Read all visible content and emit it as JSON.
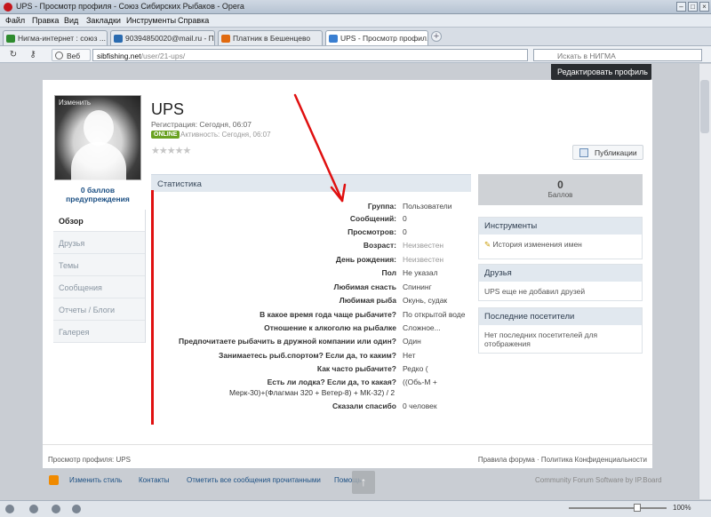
{
  "window": {
    "title": "UPS - Просмотр профиля - Союз Сибирских Рыбаков - Opera"
  },
  "menu": [
    "Файл",
    "Правка",
    "Вид",
    "Закладки",
    "Инструменты",
    "Справка"
  ],
  "tabs": [
    {
      "label": "Нигма-интернет : союз ...",
      "color": "#2e8b2e"
    },
    {
      "label": "90394850020@mail.ru - П...",
      "color": "#2a6bb0"
    },
    {
      "label": "Платник в Бешенцево",
      "color": "#e06a10"
    },
    {
      "label": "UPS - Просмотр профил...",
      "color": "#3a7fd1"
    }
  ],
  "address": {
    "web_label": "Веб",
    "host": "sibfishing.net",
    "path": "/user/21-ups/",
    "search_placeholder": "Искать в НИГМА"
  },
  "page": {
    "edit_profile": "Редактировать профиль",
    "avatar_change": "Изменить",
    "points_link": "0 баллов предупреждения",
    "nav": [
      "Обзор",
      "Друзья",
      "Темы",
      "Сообщения",
      "Отчеты / Блоги",
      "Галерея"
    ],
    "username": "UPS",
    "registration": "Регистрация: Сегодня, 06:07",
    "online_badge": "ONLINE",
    "activity": "Активность: Сегодня, 06:07",
    "stars": "★★★★★",
    "publications_button": "Публикации",
    "stats_header": "Статистика",
    "stats": [
      {
        "label": "Группа:",
        "value": "Пользователи",
        "gray": false
      },
      {
        "label": "Сообщений:",
        "value": "0",
        "gray": false
      },
      {
        "label": "Просмотров:",
        "value": "0",
        "gray": false
      },
      {
        "label": "Возраст:",
        "value": "Неизвестен",
        "gray": true
      },
      {
        "label": "День рождения:",
        "value": "Неизвестен",
        "gray": true
      },
      {
        "label": "Пол",
        "value": "Не указал",
        "gray": false
      },
      {
        "label": "Любимая снасть",
        "value": "Спининг",
        "gray": false
      },
      {
        "label": "Любимая рыба",
        "value": "Окунь, судак",
        "gray": false
      },
      {
        "label": "В какое время года чаще рыбачите?",
        "value": "По открытой воде",
        "gray": false
      },
      {
        "label": "Отношение к алкоголю на рыбалке",
        "value": "Сложное...",
        "gray": false
      },
      {
        "label": "Предпочитаете рыбачить в дружной компании или один?",
        "value": "Один",
        "gray": false
      },
      {
        "label": "Занимаетесь рыб.спортом? Если да, то каким?",
        "value": "Нет",
        "gray": false
      },
      {
        "label": "Как часто рыбачите?",
        "value": "Редко (",
        "gray": false
      },
      {
        "label": "Есть ли лодка? Если да, то какая?",
        "value": "((Обь-М +",
        "gray": false
      },
      {
        "label": "Мерк-30)+(Флагман 320 + Ветер-8) + МК-32) / 2",
        "value": "",
        "gray": false
      },
      {
        "label": "Сказали спасибо",
        "value": "0 человек",
        "gray": false
      }
    ],
    "points_value": "0",
    "points_label": "Баллов",
    "tools_header": "Инструменты",
    "tools_link": "История изменения имен",
    "friends_header": "Друзья",
    "friends_text": "UPS еще не добавил друзей",
    "visitors_header": "Последние посетители",
    "visitors_text": "Нет последних посетителей для отображения",
    "footer_left": "Просмотр профиля: UPS",
    "footer_right": "Правила форума · Политика Конфиденциальности",
    "bottom_links": [
      "Изменить стиль",
      "Контакты",
      "Отметить все сообщения прочитанными",
      "Помощь"
    ],
    "powered": "Community Forum Software by IP.Board"
  },
  "status": {
    "zoom": "100%"
  },
  "colors": {
    "annotation": "#e01010",
    "online": "#6aa221",
    "link": "#1b4f83"
  }
}
